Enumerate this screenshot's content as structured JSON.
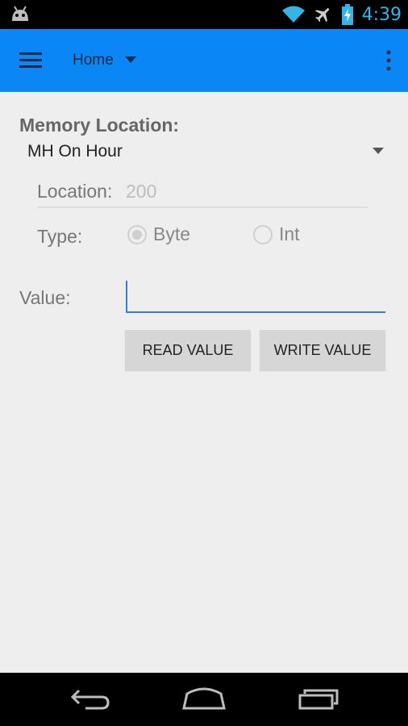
{
  "status_bar": {
    "time": "4:39",
    "icons": [
      "android-robot-icon",
      "wifi-icon",
      "airplane-mode-icon",
      "battery-charging-icon"
    ],
    "clock_color": "#33b5e5"
  },
  "action_bar": {
    "title": "Home",
    "color": "#0a86f5",
    "icons": [
      "hamburger-menu-icon",
      "dropdown-triangle-icon",
      "overflow-menu-icon"
    ]
  },
  "form": {
    "memory_location_label": "Memory Location:",
    "memory_location_value": "MH On Hour",
    "location_label": "Location:",
    "location_value": "200",
    "type_label": "Type:",
    "type_options": [
      {
        "label": "Byte",
        "selected": true
      },
      {
        "label": "Int",
        "selected": false
      }
    ],
    "value_label": "Value:",
    "value_input": "",
    "read_button": "READ VALUE",
    "write_button": "WRITE VALUE"
  },
  "nav_bar": {
    "icons": [
      "back-icon",
      "home-icon",
      "recent-apps-icon"
    ]
  }
}
